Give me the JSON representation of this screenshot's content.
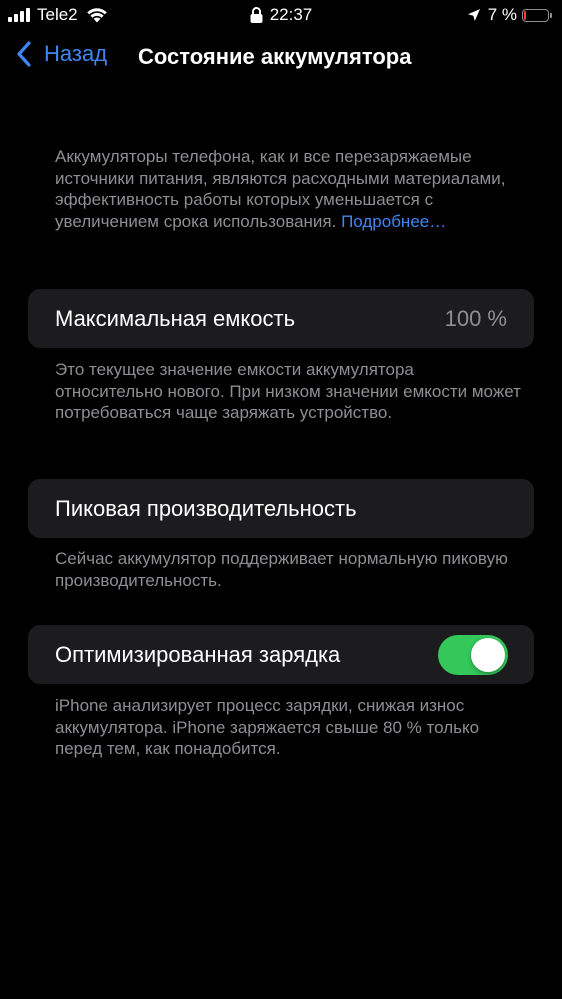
{
  "status_bar": {
    "carrier": "Tele2",
    "time": "22:37",
    "battery_percent": "7 %",
    "battery_level": 0.07,
    "battery_color": "#ff3b30"
  },
  "nav": {
    "back_label": "Назад",
    "back_icon": "chevron-left-icon",
    "title": "Состояние аккумулятора"
  },
  "intro": {
    "text": "Аккумуляторы телефона, как и все перезаряжаемые источники питания, являются расходными материалами, эффективность работы которых уменьшается с увеличением срока использования. ",
    "link": "Подробнее…"
  },
  "max_capacity": {
    "label": "Максимальная емкость",
    "value": "100 %",
    "footer": "Это текущее значение емкости аккумулятора относительно нового. При низком значении емкости может потребоваться чаще заряжать устройство."
  },
  "peak_performance": {
    "label": "Пиковая производительность",
    "footer": "Сейчас аккумулятор поддерживает нормальную пиковую производительность."
  },
  "optimized_charging": {
    "label": "Оптимизированная зарядка",
    "enabled": true,
    "footer": "iPhone анализирует процесс зарядки, снижая износ аккумулятора. iPhone заряжается свыше 80 % только перед тем, как понадобится."
  },
  "colors": {
    "accent": "#3f86f5",
    "toggle_on": "#34c759",
    "cell_background": "#1c1c1e",
    "secondary_text": "#8e8e93"
  }
}
